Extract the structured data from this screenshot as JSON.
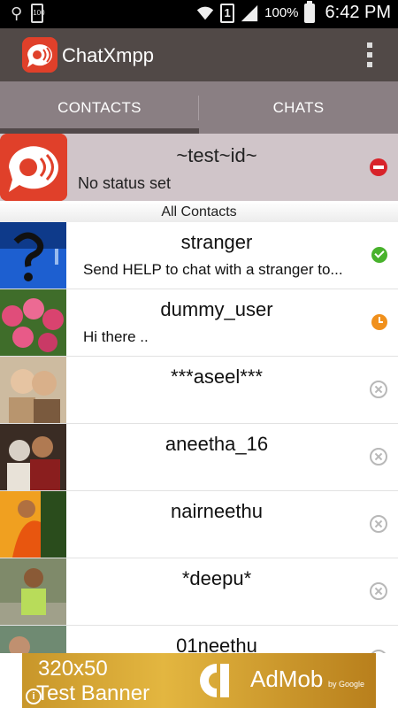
{
  "status_bar": {
    "battery_small": "100",
    "sim": "1",
    "battery_percent": "100%",
    "time": "6:42 PM"
  },
  "app": {
    "title": "ChatXmpp"
  },
  "tabs": [
    {
      "label": "CONTACTS",
      "active": true
    },
    {
      "label": "CHATS",
      "active": false
    }
  ],
  "profile": {
    "name": "~test~id~",
    "status": "No status set",
    "presence": "do-not-disturb"
  },
  "section_header": "All Contacts",
  "contacts": [
    {
      "name": "stranger",
      "status": "Send HELP to chat with a stranger to...",
      "presence": "online"
    },
    {
      "name": "dummy_user",
      "status": "Hi there  ..",
      "presence": "away"
    },
    {
      "name": "***aseel***",
      "status": "",
      "presence": "offline"
    },
    {
      "name": "aneetha_16",
      "status": "",
      "presence": "offline"
    },
    {
      "name": "nairneethu",
      "status": "",
      "presence": "offline"
    },
    {
      "name": "*deepu*",
      "status": "",
      "presence": "offline"
    },
    {
      "name": "01neethu",
      "status": "",
      "presence": "offline"
    }
  ],
  "ad": {
    "size_text": "320x50",
    "banner_text": "Test Banner",
    "info": "i",
    "brand": "AdMob",
    "by": "by Google"
  },
  "colors": {
    "action_bar": "#514947",
    "tabs": "#8a7f83",
    "profile_bg": "#d0c5c9",
    "brand_red": "#e0402a",
    "online": "#48b22c",
    "away": "#f0901c",
    "dnd": "#d8232a"
  }
}
